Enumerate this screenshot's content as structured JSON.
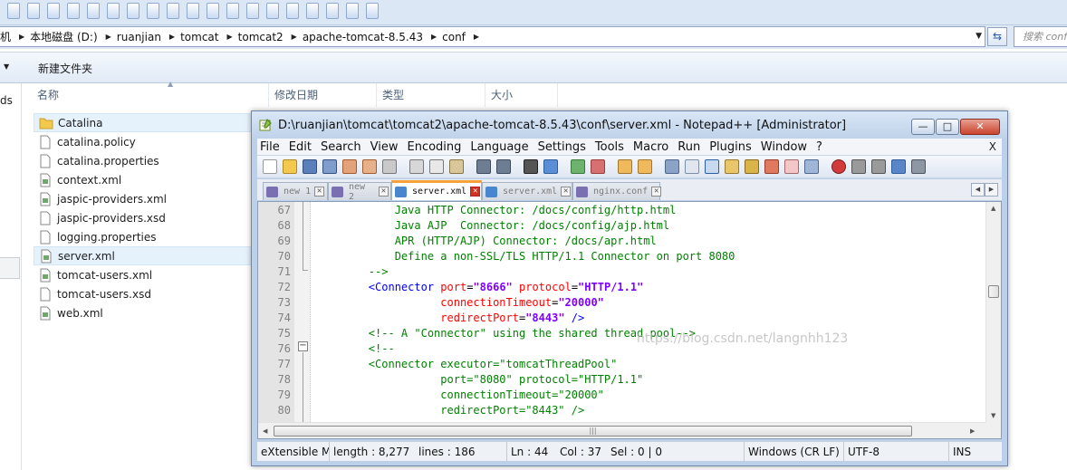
{
  "explorer": {
    "breadcrumbs": [
      "机",
      "本地磁盘 (D:)",
      "ruanjian",
      "tomcat",
      "tomcat2",
      "apache-tomcat-8.5.43",
      "conf"
    ],
    "search_placeholder": "搜索 conf",
    "toolbar": {
      "new_folder": "新建文件夹"
    },
    "columns": [
      "名称",
      "修改日期",
      "类型",
      "大小"
    ],
    "nav_fragment": "ds",
    "files": [
      {
        "name": "Catalina",
        "icon": "folder-icon"
      },
      {
        "name": "catalina.policy",
        "icon": "file-icon"
      },
      {
        "name": "catalina.properties",
        "icon": "file-icon"
      },
      {
        "name": "context.xml",
        "icon": "xml-file-icon"
      },
      {
        "name": "jaspic-providers.xml",
        "icon": "xml-file-icon"
      },
      {
        "name": "jaspic-providers.xsd",
        "icon": "file-icon"
      },
      {
        "name": "logging.properties",
        "icon": "file-icon"
      },
      {
        "name": "server.xml",
        "icon": "xml-file-icon"
      },
      {
        "name": "tomcat-users.xml",
        "icon": "xml-file-icon"
      },
      {
        "name": "tomcat-users.xsd",
        "icon": "file-icon"
      },
      {
        "name": "web.xml",
        "icon": "xml-file-icon"
      }
    ]
  },
  "notepad": {
    "title": "D:\\ruanjian\\tomcat\\tomcat2\\apache-tomcat-8.5.43\\conf\\server.xml - Notepad++ [Administrator]",
    "window_buttons": {
      "minimize": "—",
      "maximize": "□",
      "close": "✕"
    },
    "menu": [
      "File",
      "Edit",
      "Search",
      "View",
      "Encoding",
      "Language",
      "Settings",
      "Tools",
      "Macro",
      "Run",
      "Plugins",
      "Window",
      "?"
    ],
    "menu_close": "X",
    "tabs": [
      {
        "label": "new 1",
        "active": false
      },
      {
        "label": "new 2",
        "active": false
      },
      {
        "label": "server.xml",
        "active": true
      },
      {
        "label": "server.xml",
        "active": false
      },
      {
        "label": "nginx.conf",
        "active": false
      }
    ],
    "code_lines": [
      {
        "n": "67",
        "parts": [
          {
            "t": "            Java HTTP Connector: /docs/config/http.html",
            "c": "cmt"
          }
        ]
      },
      {
        "n": "68",
        "parts": [
          {
            "t": "            Java AJP  Connector: /docs/config/ajp.html",
            "c": "cmt"
          }
        ]
      },
      {
        "n": "69",
        "parts": [
          {
            "t": "            APR (HTTP/AJP) Connector: /docs/apr.html",
            "c": "cmt"
          }
        ]
      },
      {
        "n": "70",
        "parts": [
          {
            "t": "            Define a non-SSL/TLS HTTP/1.1 Connector on port 8080",
            "c": "cmt"
          }
        ]
      },
      {
        "n": "71",
        "parts": [
          {
            "t": "        -->",
            "c": "cmt"
          }
        ]
      },
      {
        "n": "72",
        "parts": [
          {
            "t": "        <Connector ",
            "c": "tag"
          },
          {
            "t": "port",
            "c": "attr"
          },
          {
            "t": "=",
            "c": "txt"
          },
          {
            "t": "\"8666\"",
            "c": "val"
          },
          {
            "t": " protocol",
            "c": "attr"
          },
          {
            "t": "=",
            "c": "txt"
          },
          {
            "t": "\"HTTP/1.1\"",
            "c": "val"
          }
        ]
      },
      {
        "n": "73",
        "parts": [
          {
            "t": "                   connectionTimeout",
            "c": "attr"
          },
          {
            "t": "=",
            "c": "txt"
          },
          {
            "t": "\"20000\"",
            "c": "val"
          }
        ]
      },
      {
        "n": "74",
        "parts": [
          {
            "t": "                   redirectPort",
            "c": "attr"
          },
          {
            "t": "=",
            "c": "txt"
          },
          {
            "t": "\"8443\"",
            "c": "val"
          },
          {
            "t": " />",
            "c": "tag"
          }
        ]
      },
      {
        "n": "75",
        "parts": [
          {
            "t": "        <!-- A \"Connector\" using the shared thread pool-->",
            "c": "cmt"
          }
        ]
      },
      {
        "n": "76",
        "parts": [
          {
            "t": "        <!--",
            "c": "cmt"
          }
        ]
      },
      {
        "n": "77",
        "parts": [
          {
            "t": "        <Connector executor=\"tomcatThreadPool\"",
            "c": "cmt"
          }
        ]
      },
      {
        "n": "78",
        "parts": [
          {
            "t": "                   port=\"8080\" protocol=\"HTTP/1.1\"",
            "c": "cmt"
          }
        ]
      },
      {
        "n": "79",
        "parts": [
          {
            "t": "                   connectionTimeout=\"20000\"",
            "c": "cmt"
          }
        ]
      },
      {
        "n": "80",
        "parts": [
          {
            "t": "                   redirectPort=\"8443\" />",
            "c": "cmt"
          }
        ]
      }
    ],
    "status": {
      "file_type": "eXtensible M",
      "length": "length : 8,277",
      "lines": "lines : 186",
      "ln": "Ln : 44",
      "col": "Col : 37",
      "sel": "Sel : 0 | 0",
      "eol": "Windows (CR LF)",
      "encoding": "UTF-8",
      "mode": "INS"
    },
    "watermark": "https://blog.csdn.net/langnhh123"
  },
  "colors": {
    "comment": "#008000",
    "tag": "#0000ff",
    "attribute": "#ff0000",
    "value": "#8000ff",
    "active_tab_accent": "#f7a13b",
    "title_bar": "#bfd2ea"
  }
}
